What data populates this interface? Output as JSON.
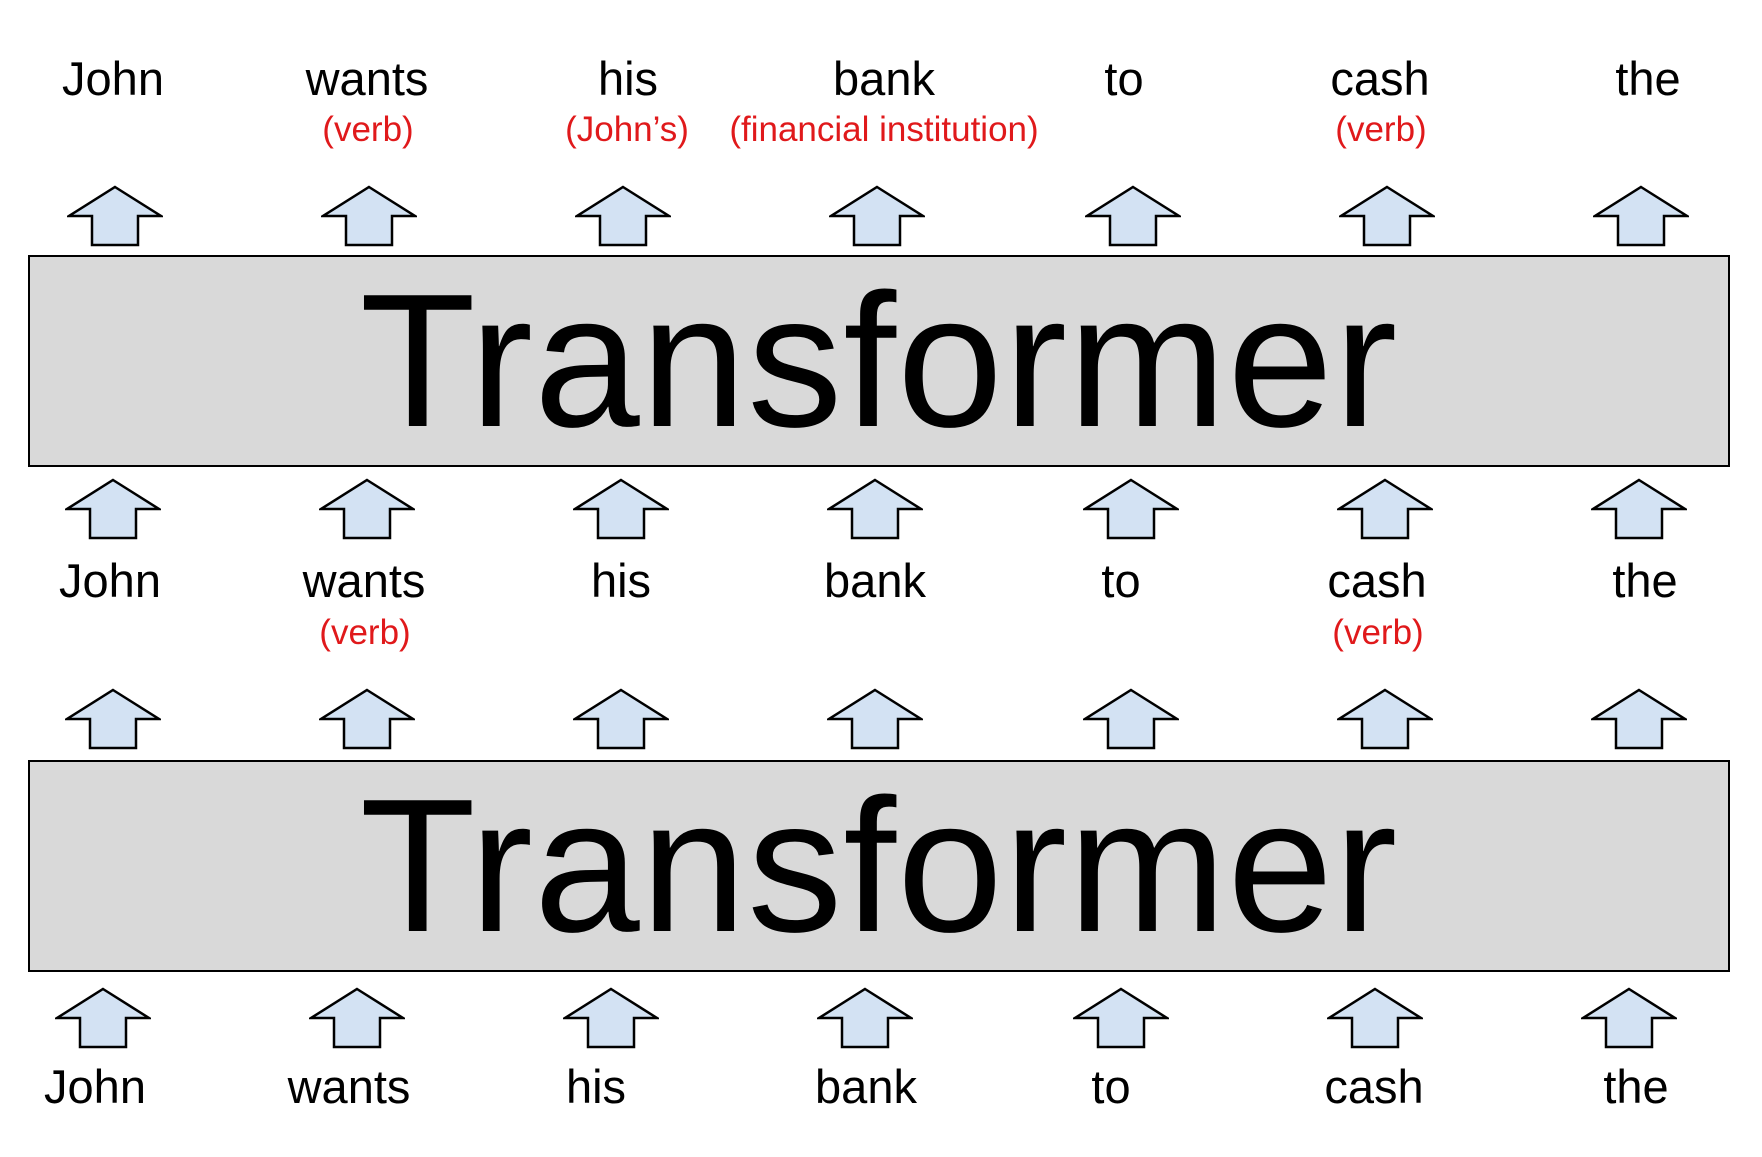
{
  "diagram": {
    "block_label": "Transformer",
    "arrow_fill": "#d3e2f3",
    "annotation_color": "#e0191b",
    "input_row": {
      "words": [
        "John",
        "wants",
        "his",
        "bank",
        "to",
        "cash",
        "the"
      ]
    },
    "middle_row": {
      "words": [
        "John",
        "wants",
        "his",
        "bank",
        "to",
        "cash",
        "the"
      ],
      "annotations": [
        "",
        "(verb)",
        "",
        "",
        "",
        "(verb)",
        ""
      ]
    },
    "output_row": {
      "words": [
        "John",
        "wants",
        "his",
        "bank",
        "to",
        "cash",
        "the"
      ],
      "annotations": [
        "",
        "(verb)",
        "(John’s)",
        "(financial institution)",
        "",
        "(verb)",
        ""
      ]
    }
  }
}
